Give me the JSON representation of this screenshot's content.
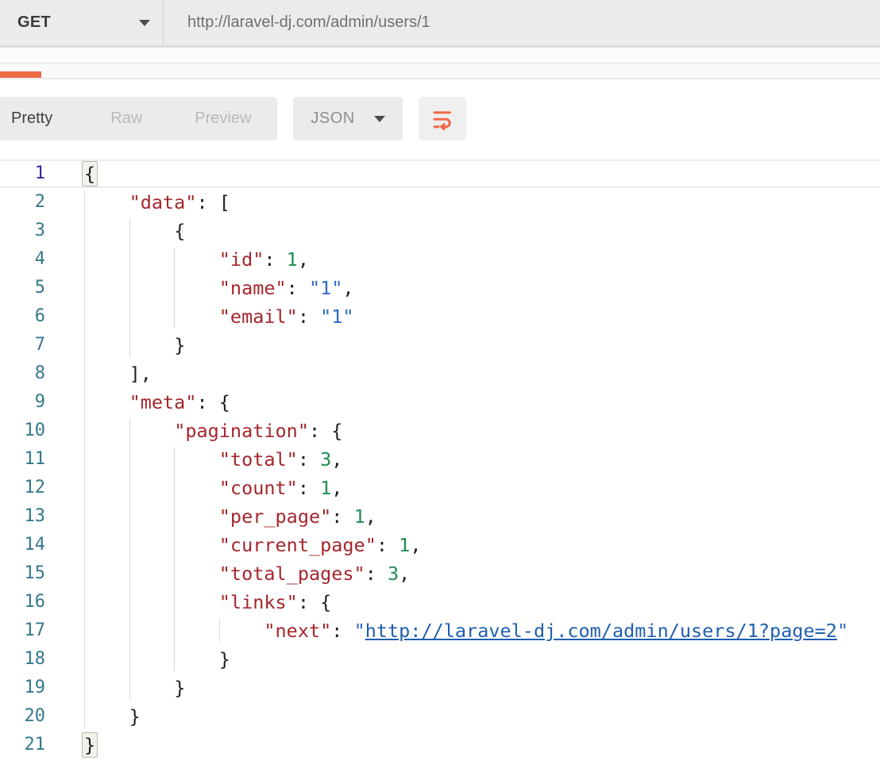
{
  "request_bar": {
    "method": "GET",
    "url": "http://laravel-dj.com/admin/users/1"
  },
  "response_toolbar": {
    "view_tabs": [
      {
        "label": "Pretty",
        "active": true
      },
      {
        "label": "Raw",
        "active": false
      },
      {
        "label": "Preview",
        "active": false
      }
    ],
    "language_select": {
      "value": "JSON"
    },
    "wrap_button_icon": "text-wrap-icon"
  },
  "colors": {
    "accent_orange": "#EE6A45",
    "toolbar_button_bg": "#EBEBEB",
    "json_key": "#A5262D",
    "json_number": "#218C52",
    "json_string": "#2A6BC5",
    "json_link": "#1F5FAD",
    "line_number": "#35788C",
    "active_line_number": "#282DA0"
  },
  "editor": {
    "active_line": 1,
    "line_height": 36,
    "guides": [
      {
        "col": 0,
        "from": 2,
        "to": 20
      },
      {
        "col": 4,
        "from": 3,
        "to": 7
      },
      {
        "col": 8,
        "from": 4,
        "to": 6
      },
      {
        "col": 4,
        "from": 10,
        "to": 19
      },
      {
        "col": 8,
        "from": 11,
        "to": 18
      },
      {
        "col": 12,
        "from": 17,
        "to": 17
      }
    ],
    "lines": [
      {
        "n": 1,
        "indent": 0,
        "tokens": [
          {
            "c": "p",
            "t": "{",
            "m": true
          }
        ]
      },
      {
        "n": 2,
        "indent": 4,
        "tokens": [
          {
            "c": "key",
            "t": "\"data\""
          },
          {
            "c": "p",
            "t": ": ["
          }
        ]
      },
      {
        "n": 3,
        "indent": 8,
        "tokens": [
          {
            "c": "p",
            "t": "{"
          }
        ]
      },
      {
        "n": 4,
        "indent": 12,
        "tokens": [
          {
            "c": "key",
            "t": "\"id\""
          },
          {
            "c": "p",
            "t": ": "
          },
          {
            "c": "num",
            "t": "1"
          },
          {
            "c": "p",
            "t": ","
          }
        ]
      },
      {
        "n": 5,
        "indent": 12,
        "tokens": [
          {
            "c": "key",
            "t": "\"name\""
          },
          {
            "c": "p",
            "t": ": "
          },
          {
            "c": "str",
            "t": "\"1\""
          },
          {
            "c": "p",
            "t": ","
          }
        ]
      },
      {
        "n": 6,
        "indent": 12,
        "tokens": [
          {
            "c": "key",
            "t": "\"email\""
          },
          {
            "c": "p",
            "t": ": "
          },
          {
            "c": "str",
            "t": "\"1\""
          }
        ]
      },
      {
        "n": 7,
        "indent": 8,
        "tokens": [
          {
            "c": "p",
            "t": "}"
          }
        ]
      },
      {
        "n": 8,
        "indent": 4,
        "tokens": [
          {
            "c": "p",
            "t": "],"
          }
        ]
      },
      {
        "n": 9,
        "indent": 4,
        "tokens": [
          {
            "c": "key",
            "t": "\"meta\""
          },
          {
            "c": "p",
            "t": ": {"
          }
        ]
      },
      {
        "n": 10,
        "indent": 8,
        "tokens": [
          {
            "c": "key",
            "t": "\"pagination\""
          },
          {
            "c": "p",
            "t": ": {"
          }
        ]
      },
      {
        "n": 11,
        "indent": 12,
        "tokens": [
          {
            "c": "key",
            "t": "\"total\""
          },
          {
            "c": "p",
            "t": ": "
          },
          {
            "c": "num",
            "t": "3"
          },
          {
            "c": "p",
            "t": ","
          }
        ]
      },
      {
        "n": 12,
        "indent": 12,
        "tokens": [
          {
            "c": "key",
            "t": "\"count\""
          },
          {
            "c": "p",
            "t": ": "
          },
          {
            "c": "num",
            "t": "1"
          },
          {
            "c": "p",
            "t": ","
          }
        ]
      },
      {
        "n": 13,
        "indent": 12,
        "tokens": [
          {
            "c": "key",
            "t": "\"per_page\""
          },
          {
            "c": "p",
            "t": ": "
          },
          {
            "c": "num",
            "t": "1"
          },
          {
            "c": "p",
            "t": ","
          }
        ]
      },
      {
        "n": 14,
        "indent": 12,
        "tokens": [
          {
            "c": "key",
            "t": "\"current_page\""
          },
          {
            "c": "p",
            "t": ": "
          },
          {
            "c": "num",
            "t": "1"
          },
          {
            "c": "p",
            "t": ","
          }
        ]
      },
      {
        "n": 15,
        "indent": 12,
        "tokens": [
          {
            "c": "key",
            "t": "\"total_pages\""
          },
          {
            "c": "p",
            "t": ": "
          },
          {
            "c": "num",
            "t": "3"
          },
          {
            "c": "p",
            "t": ","
          }
        ]
      },
      {
        "n": 16,
        "indent": 12,
        "tokens": [
          {
            "c": "key",
            "t": "\"links\""
          },
          {
            "c": "p",
            "t": ": {"
          }
        ]
      },
      {
        "n": 17,
        "indent": 16,
        "tokens": [
          {
            "c": "key",
            "t": "\"next\""
          },
          {
            "c": "p",
            "t": ": "
          },
          {
            "c": "str",
            "t": "\""
          },
          {
            "c": "link",
            "t": "http://laravel-dj.com/admin/users/1?page=2"
          },
          {
            "c": "str",
            "t": "\""
          }
        ]
      },
      {
        "n": 18,
        "indent": 12,
        "tokens": [
          {
            "c": "p",
            "t": "}"
          }
        ]
      },
      {
        "n": 19,
        "indent": 8,
        "tokens": [
          {
            "c": "p",
            "t": "}"
          }
        ]
      },
      {
        "n": 20,
        "indent": 4,
        "tokens": [
          {
            "c": "p",
            "t": "}"
          }
        ]
      },
      {
        "n": 21,
        "indent": 0,
        "tokens": [
          {
            "c": "p",
            "t": "}",
            "m": true
          }
        ]
      }
    ]
  }
}
